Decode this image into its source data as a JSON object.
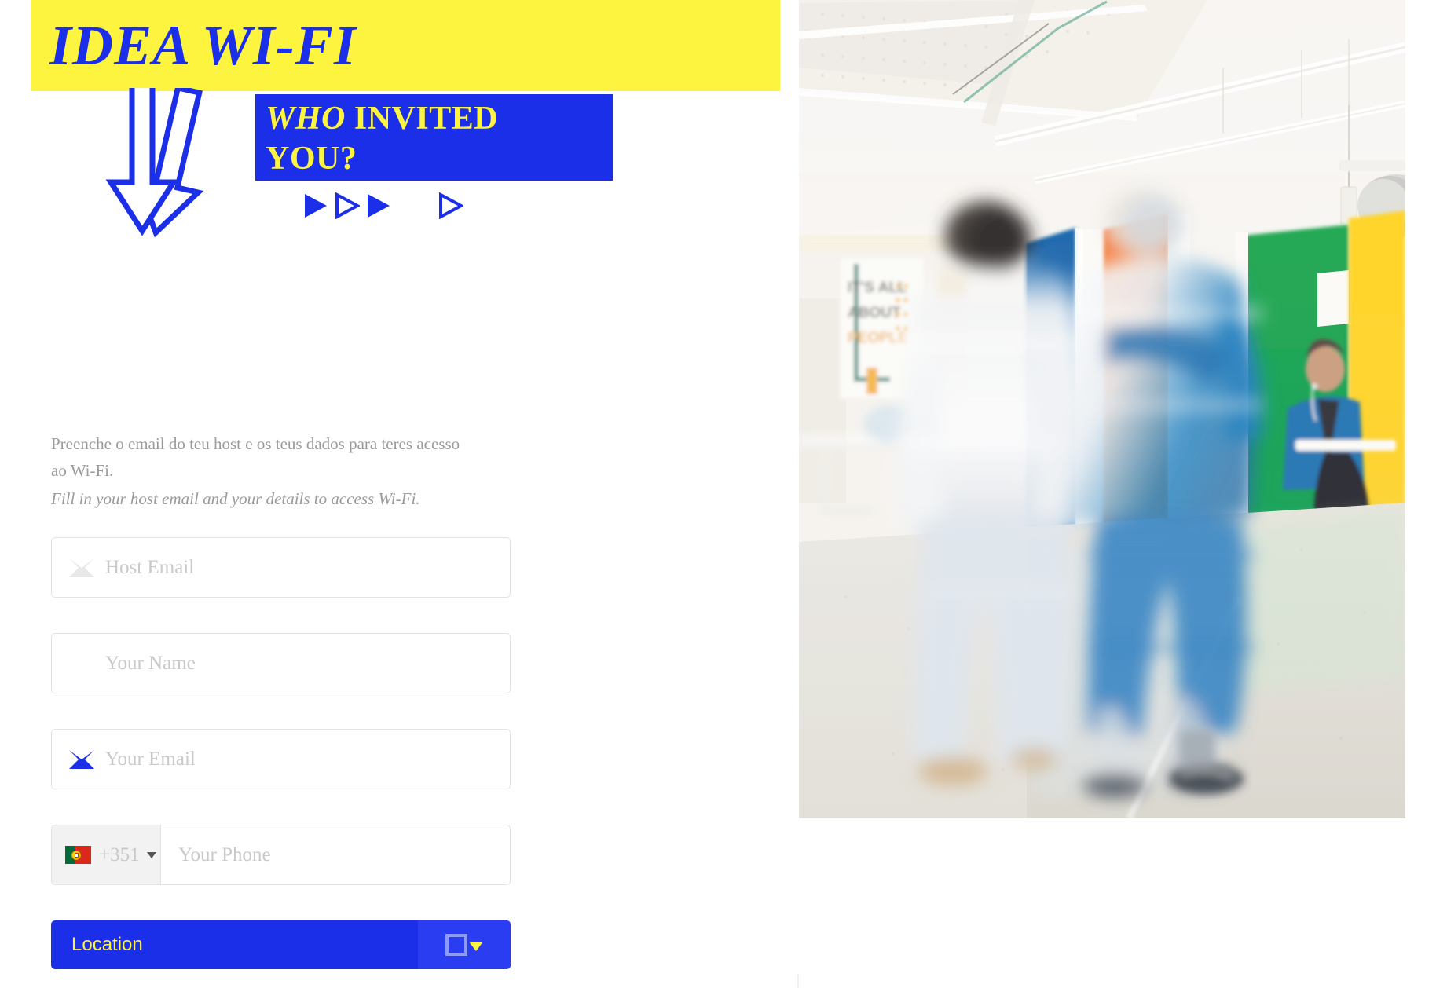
{
  "brand": {
    "title": "IDEA WI-FI",
    "title_bg_color": "#fdf43f",
    "title_text_color": "#1c2fe8"
  },
  "headline": {
    "line1_italic": "WHO",
    "line1_rest": " INVITED",
    "line2": "YOU?",
    "bg_color": "#1c2fe8",
    "text_color": "#fdf43f"
  },
  "decoration": {
    "down_arrow_icon": "double-down-arrow-outline",
    "triangles": [
      {
        "name": "play-triangle-filled",
        "style": "filled"
      },
      {
        "name": "play-triangle-outline",
        "style": "outline"
      },
      {
        "name": "play-triangle-filled",
        "style": "filled"
      },
      {
        "name": "play-triangle-outline",
        "style": "outline"
      }
    ]
  },
  "intro": {
    "pt_line1": "Preenche o email do teu host e os teus dados para teres acesso",
    "pt_line2": "ao Wi-Fi.",
    "en": "Fill in your host email and your details to access Wi-Fi."
  },
  "form": {
    "host_email": {
      "placeholder": "Host Email",
      "icon": "envelope-icon",
      "icon_color": "#e6e6e6",
      "value": ""
    },
    "your_name": {
      "placeholder": "Your Name",
      "value": ""
    },
    "your_email": {
      "placeholder": "Your Email",
      "icon": "envelope-icon",
      "icon_color": "#1c2fe8",
      "value": ""
    },
    "your_phone": {
      "placeholder": "Your Phone",
      "dial_code": "+351",
      "flag": "portugal-flag-icon",
      "value": ""
    },
    "location": {
      "label": "Location",
      "bg_color": "#1c2fe8",
      "label_color": "#fdf43f",
      "toggle_icon": "square-outline-caret-down-icon"
    }
  },
  "photo": {
    "alt": "motion-blurred people walking through colorful coworking office",
    "poster_line1": "IT'S ALL",
    "poster_line2": "ABOUT",
    "poster_line3": "PEOPLE"
  }
}
